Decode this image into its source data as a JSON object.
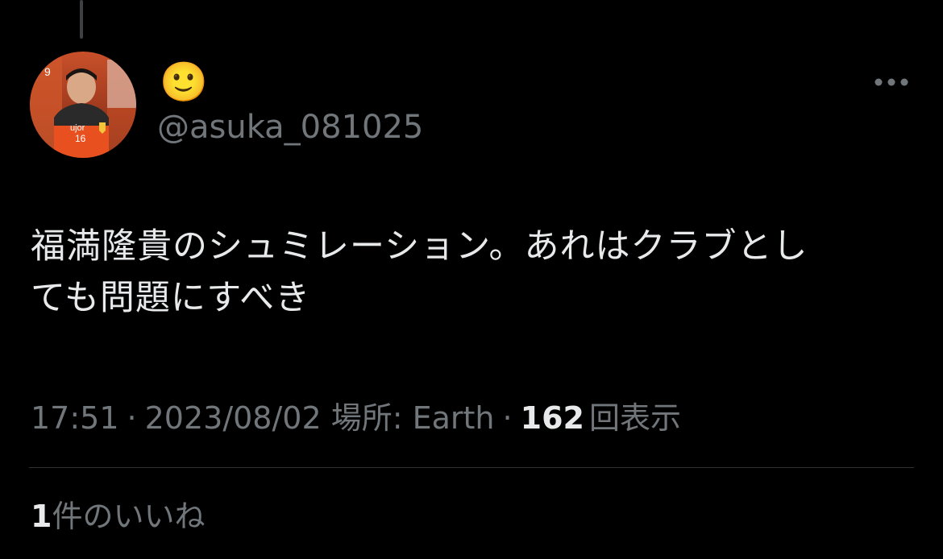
{
  "tweet": {
    "display_name": "🙂",
    "handle": "@asuka_081025",
    "text_line1": "福満隆貴のシュミレーション。あれはクラブとし",
    "text_line2": "ても問題にすべき",
    "time": "17:51",
    "separator": "·",
    "date": "2023/08/02",
    "location_label": "場所: Earth",
    "views_count": "162",
    "views_label": "回表示",
    "likes_count": "1",
    "likes_label": "件のいいね"
  },
  "icons": {
    "more": "more-horizontal-icon",
    "avatar": "profile-avatar"
  },
  "colors": {
    "background": "#000000",
    "primary_text": "#e7e9ea",
    "secondary_text": "#71767b",
    "divider": "#2f3336"
  }
}
